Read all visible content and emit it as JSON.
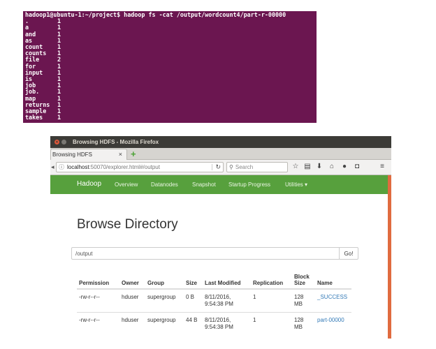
{
  "terminal": {
    "prompt": "hadoop1@ubuntu-1:~/project$ hadoop fs -cat /output/wordcount4/part-r-00000",
    "rows": [
      {
        "word": ".",
        "count": "1"
      },
      {
        "word": "a",
        "count": "1"
      },
      {
        "word": "and",
        "count": "1"
      },
      {
        "word": "as",
        "count": "1"
      },
      {
        "word": "count",
        "count": "1"
      },
      {
        "word": "counts",
        "count": "1"
      },
      {
        "word": "file",
        "count": "2"
      },
      {
        "word": "for",
        "count": "1"
      },
      {
        "word": "input",
        "count": "1"
      },
      {
        "word": "is",
        "count": "1"
      },
      {
        "word": "job",
        "count": "1"
      },
      {
        "word": "job.",
        "count": "1"
      },
      {
        "word": "map",
        "count": "1"
      },
      {
        "word": "returns",
        "count": "1"
      },
      {
        "word": "sample",
        "count": "1"
      },
      {
        "word": "takes",
        "count": "1"
      }
    ]
  },
  "browser": {
    "window_title": "Browsing HDFS - Mozilla Firefox",
    "tab_label": "Browsing HDFS",
    "tab_close": "×",
    "new_tab": "+",
    "url_host": "localhost",
    "url_rest": ":50070/explorer.html#/output",
    "search_placeholder": "Search"
  },
  "hadoop_nav": {
    "brand": "Hadoop",
    "links": [
      "Overview",
      "Datanodes",
      "Snapshot",
      "Startup Progress",
      "Utilities ▾"
    ]
  },
  "page": {
    "title": "Browse Directory",
    "path_value": "/output",
    "go_label": "Go!"
  },
  "table": {
    "headers": [
      "Permission",
      "Owner",
      "Group",
      "Size",
      "Last Modified",
      "Replication",
      "Block Size",
      "Name"
    ],
    "rows": [
      [
        "-rw-r--r--",
        "hduser",
        "supergroup",
        "0 B",
        "8/11/2016, 9:54:38 PM",
        "1",
        "128 MB",
        "_SUCCESS"
      ],
      [
        "-rw-r--r--",
        "hduser",
        "supergroup",
        "44 B",
        "8/11/2016, 9:54:38 PM",
        "1",
        "128 MB",
        "part-00000"
      ]
    ]
  },
  "colors": {
    "terminal_bg": "#6b1650",
    "hadoop_green": "#57a03d",
    "link_blue": "#337ab7"
  }
}
